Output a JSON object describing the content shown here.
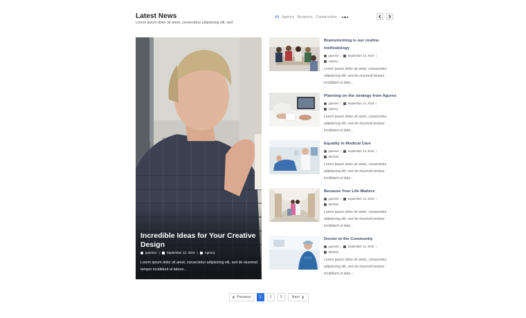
{
  "header": {
    "title": "Latest News",
    "subtitle": "Lorem ipsum dolor sit amet, consectetur adipisicing elit, sed",
    "filters": [
      {
        "label": "All",
        "active": true
      },
      {
        "label": "Agency",
        "active": false
      },
      {
        "label": "Business",
        "active": false
      },
      {
        "label": "Construction",
        "active": false
      }
    ],
    "more_icon": "ellipsis-icon",
    "prev_icon": "chevron-left-icon",
    "next_icon": "chevron-right-icon"
  },
  "featured": {
    "title": "Incredible Ideas for Your Creative Design",
    "author": "gutentor",
    "date": "September 12, 2019",
    "category": "Agency",
    "excerpt": "Lorem ipsum dolor sit amet, consectetur adipisicing elit, sed do eiusmod tempor incididunt ut labore..."
  },
  "posts": [
    {
      "title": "Brainstorming is our routine methodology",
      "author": "gutentor",
      "date": "September 12, 2019",
      "category": "Agency",
      "excerpt": "Lorem ipsum dolor sit amet, consectetur adipisicing elit, sed do eiusmod tempor incididunt ut labo..."
    },
    {
      "title": "Planning on the strategy from figures",
      "author": "gutentor",
      "date": "September 12, 2019",
      "category": "Agency",
      "excerpt": "Lorem ipsum dolor sit amet, consectetur adipisicing elit, sed do eiusmod tempor incididunt ut labo..."
    },
    {
      "title": "Equality in Medical Care",
      "author": "gutentor",
      "date": "September 12, 2019",
      "category": "Medical",
      "excerpt": "Lorem ipsum dolor sit amet, consectetur adipisicing elit, sed do eiusmod tempor incididunt ut labo..."
    },
    {
      "title": "Because Your Life Matters",
      "author": "gutentor",
      "date": "September 12, 2019",
      "category": "Medical",
      "excerpt": "Lorem ipsum dolor sit amet, consectetur adipisicing elit, sed do eiusmod tempor incididunt ut labo..."
    },
    {
      "title": "Doctor to the Community",
      "author": "gutentor",
      "date": "September 12, 2019",
      "category": "Medical",
      "excerpt": "Lorem ipsum dolor sit amet, consectetur adipisicing elit, sed do eiusmod tempor incididunt ut labo..."
    }
  ],
  "meta_separator": "|",
  "pagination": {
    "previous": "Previous",
    "pages": [
      "1",
      "2",
      "3"
    ],
    "current": "1",
    "next": "Next"
  },
  "colors": {
    "accent": "#2b6fe0",
    "title_text": "#3e4a66"
  }
}
